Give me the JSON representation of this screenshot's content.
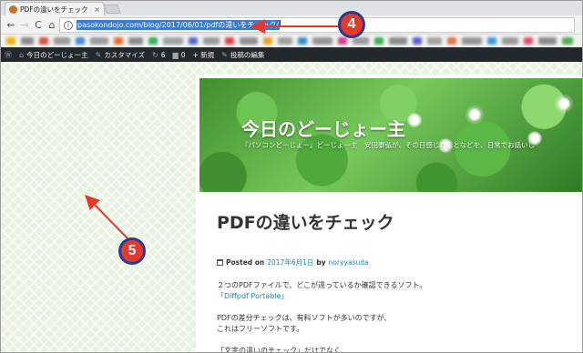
{
  "browser": {
    "tab_title": "PDFの違いをチェック | 今日",
    "tab_close": "×",
    "url": "pasokondojo.com/blog/2017/06/01/pdfの違いをチェック/",
    "info_symbol": "i",
    "back": "←",
    "forward": "→",
    "reload": "C",
    "home": "⌂"
  },
  "adminbar": {
    "wp_logo": "Ⓦ",
    "site_name": "今日のどーじょー主",
    "customize": "カスタマイズ",
    "updates_count": "6",
    "comments_count": "0",
    "new_label": "+ 新規",
    "edit_label": "投稿の編集"
  },
  "site": {
    "title": "今日のどーじょー主",
    "description": "『パソコンどーじょー』どーじょー主　安田泰弘が、その日感じたことなどを、日常でお話いし"
  },
  "post": {
    "title": "PDFの違いをチェック",
    "meta_prefix": "Posted on",
    "date": "2017年6月1日",
    "by": "by",
    "author": "noryyasuda",
    "line1": "２つのPDFファイルで、どこが違っているか確認できるソフト。",
    "line2": "「Diffpdf Portable」",
    "line3": "PDFの差分チェックは、有料ソフトが多いのですが、",
    "line4": "これはフリーソフトです。",
    "line5": "「文字の違いのチェック」だけでなく、"
  },
  "annotations": {
    "badge4": "4",
    "badge5": "5",
    "color": "#e23a2c"
  }
}
